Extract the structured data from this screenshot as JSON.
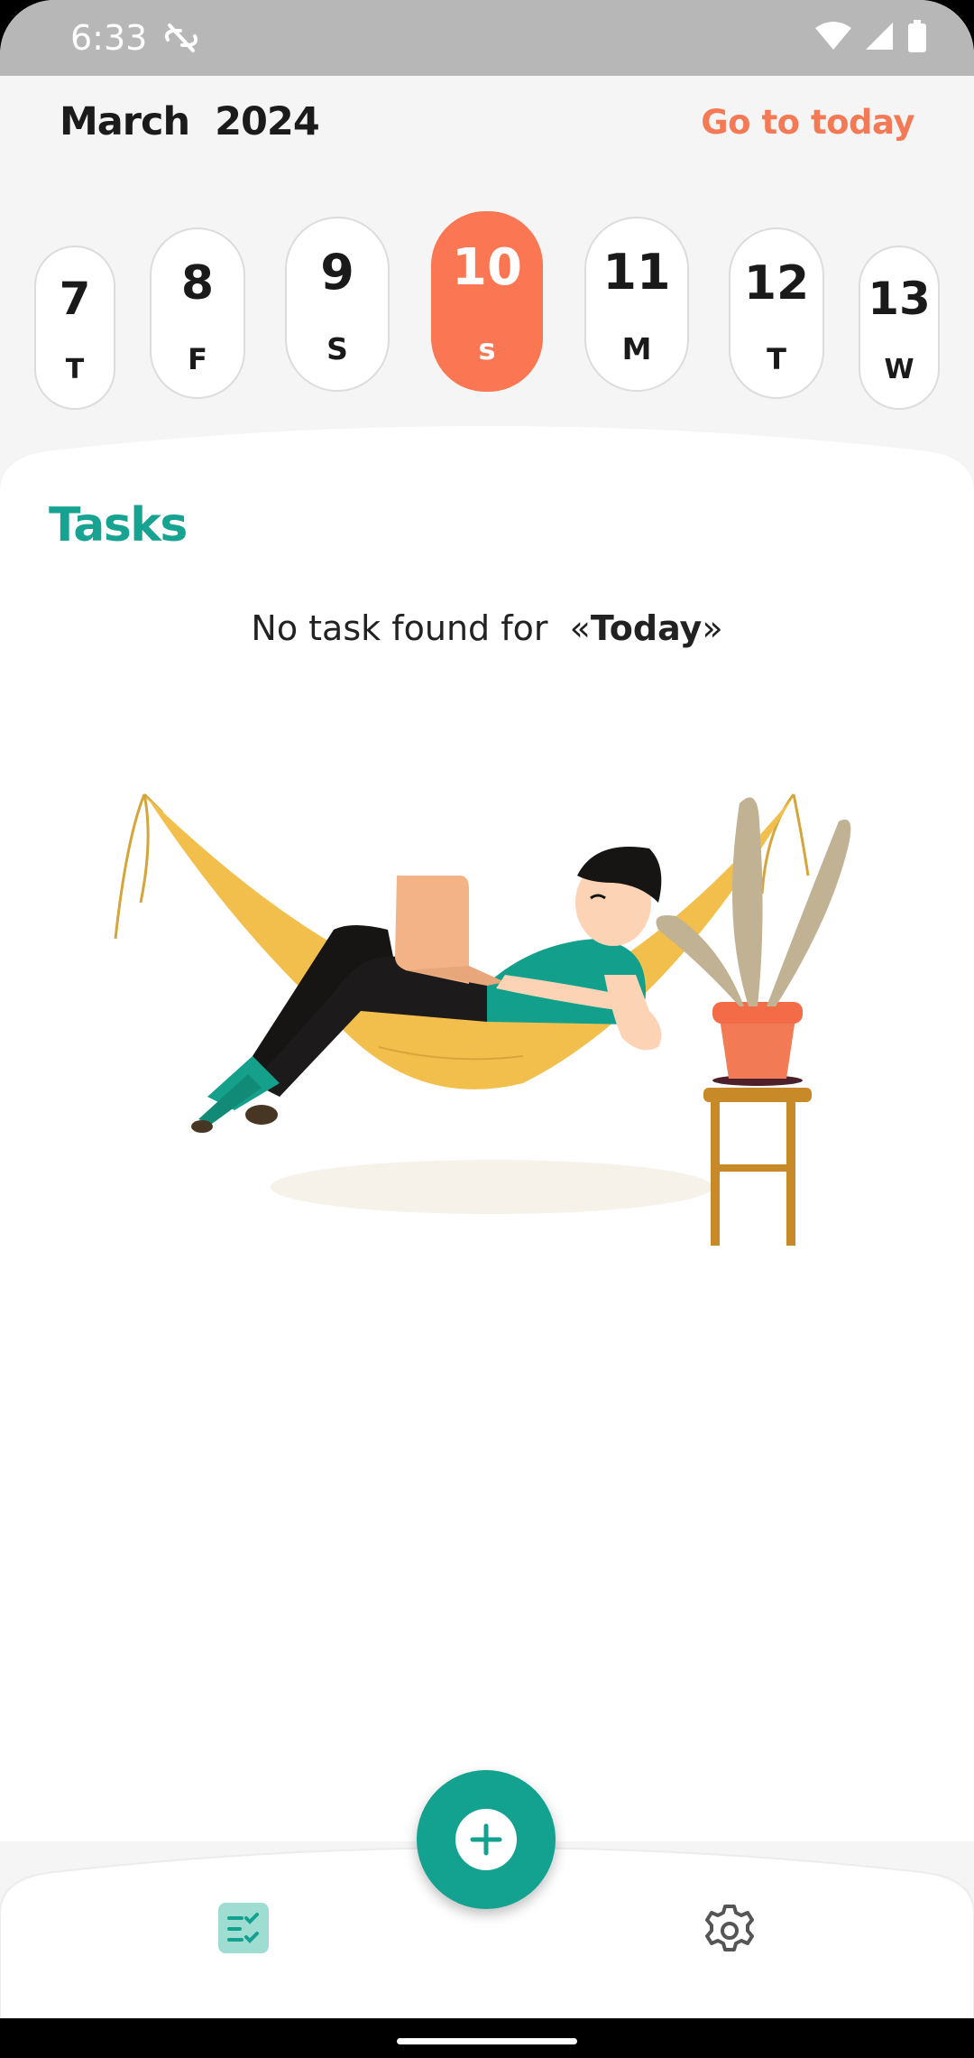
{
  "status_bar": {
    "time": "6:33"
  },
  "header": {
    "month": "March",
    "year": "2024",
    "go_to_today": "Go to today"
  },
  "days": [
    {
      "num": "7",
      "dow": "T"
    },
    {
      "num": "8",
      "dow": "F"
    },
    {
      "num": "9",
      "dow": "S"
    },
    {
      "num": "10",
      "dow": "s",
      "selected": true
    },
    {
      "num": "11",
      "dow": "M"
    },
    {
      "num": "12",
      "dow": "T"
    },
    {
      "num": "13",
      "dow": "W"
    }
  ],
  "tasks": {
    "title": "Tasks",
    "empty_prefix": "No task found for ",
    "empty_open": "«",
    "empty_day": "Today",
    "empty_close": "»"
  },
  "colors": {
    "accent": "#13a290",
    "highlight": "#fb7753",
    "link": "#f47a56"
  },
  "icons": {
    "fab": "plus-icon",
    "nav_tasks": "task-list-icon",
    "nav_settings": "gear-icon"
  }
}
